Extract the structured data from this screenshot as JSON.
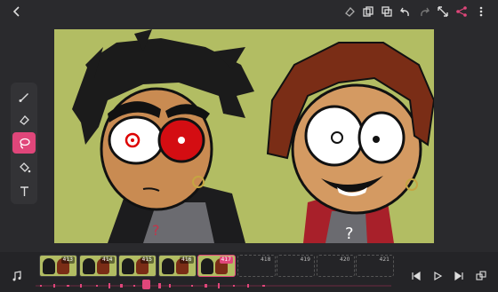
{
  "topbar": {
    "icons": [
      "back-arrow-icon",
      "eraser-icon",
      "copy-icon",
      "duplicate-icon",
      "undo-icon",
      "redo-icon",
      "expand-icon",
      "share-icon",
      "more-vertical-icon"
    ]
  },
  "tools": [
    {
      "name": "brush-tool",
      "icon": "brush-icon",
      "active": false
    },
    {
      "name": "eraser-tool",
      "icon": "eraser-icon",
      "active": false
    },
    {
      "name": "lasso-tool",
      "icon": "lasso-icon",
      "active": true
    },
    {
      "name": "fill-tool",
      "icon": "bucket-icon",
      "active": false
    },
    {
      "name": "text-tool",
      "icon": "text-icon",
      "active": false
    }
  ],
  "timeline": {
    "frames": [
      {
        "num": "413",
        "filled": true,
        "current": false
      },
      {
        "num": "414",
        "filled": true,
        "current": false
      },
      {
        "num": "415",
        "filled": true,
        "current": false
      },
      {
        "num": "416",
        "filled": true,
        "current": false
      },
      {
        "num": "417",
        "filled": true,
        "current": true
      },
      {
        "num": "418",
        "filled": false,
        "current": false
      },
      {
        "num": "419",
        "filled": false,
        "current": false
      },
      {
        "num": "420",
        "filled": false,
        "current": false
      },
      {
        "num": "421",
        "filled": false,
        "current": false
      }
    ]
  },
  "colors": {
    "accent": "#e0467a",
    "canvas_bg": "#b2bd63",
    "app_bg": "#2a2a2d"
  }
}
